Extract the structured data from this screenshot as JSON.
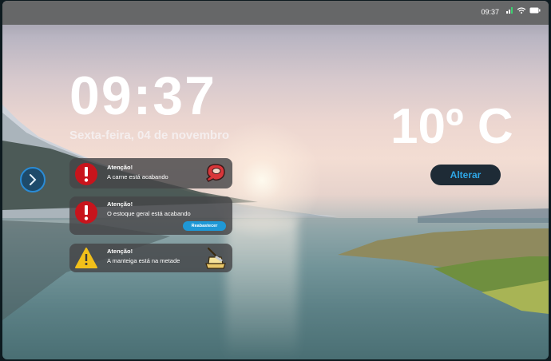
{
  "status_bar": {
    "time": "09:37"
  },
  "clock": {
    "time": "09:37",
    "date": "Sexta-feira, 04 de novembro"
  },
  "weather": {
    "temperature": "10º C",
    "change_label": "Alterar"
  },
  "notifications": [
    {
      "title": "Atenção!",
      "message": "A carne está acabando",
      "severity": "error",
      "icon": "meat-icon"
    },
    {
      "title": "Atenção!",
      "message": "O estoque geral está acabando",
      "severity": "error",
      "action_label": "Reabastecer"
    },
    {
      "title": "Atenção!",
      "message": "A manteiga está na metade",
      "severity": "warning",
      "icon": "butter-icon"
    }
  ],
  "colors": {
    "accent": "#2ea6e6",
    "error": "#c8141c",
    "warning": "#f2c01a"
  }
}
